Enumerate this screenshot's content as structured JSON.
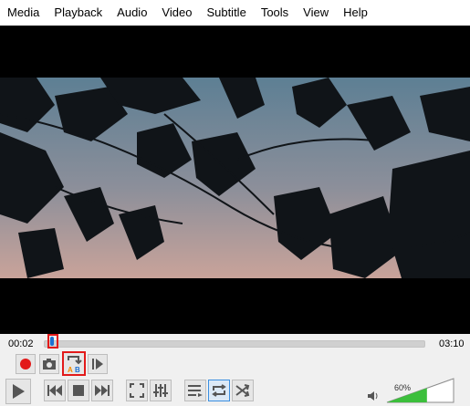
{
  "menu": [
    "Media",
    "Playback",
    "Audio",
    "Video",
    "Subtitle",
    "Tools",
    "View",
    "Help"
  ],
  "time": {
    "elapsed": "00:02",
    "total": "03:10",
    "progress": 0.011
  },
  "volume": {
    "label": "60%",
    "level": 0.6
  },
  "colors": {
    "record": "#e21a1a",
    "highlight": "#e21a1a",
    "accent": "#1c6fd1",
    "volume_fill": "#3cbf3c"
  },
  "icons": [
    "record-icon",
    "snapshot-icon",
    "ab-loop-icon",
    "frame-step-icon",
    "play-icon",
    "previous-icon",
    "stop-icon",
    "next-icon",
    "fullscreen-icon",
    "extended-settings-icon",
    "playlist-icon",
    "loop-icon",
    "shuffle-icon",
    "speaker-icon"
  ],
  "ab_loop": {
    "a": "A",
    "b": "B"
  }
}
